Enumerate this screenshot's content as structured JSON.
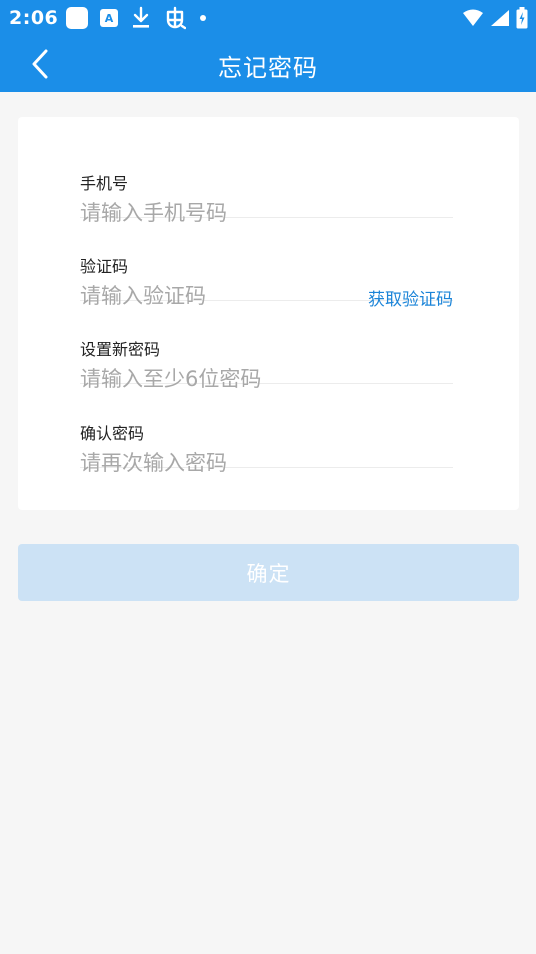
{
  "status_bar": {
    "time": "2:06",
    "notification_icons": [
      "square-icon",
      "a-badge-icon",
      "download-icon",
      "bug-icon",
      "dot-icon"
    ],
    "a_badge_text": "A",
    "system_icons": [
      "wifi-icon",
      "signal-icon",
      "battery-charging-icon"
    ]
  },
  "header": {
    "title": "忘记密码",
    "back_icon": "chevron-left-icon"
  },
  "form": {
    "fields": [
      {
        "label": "手机号",
        "placeholder": "请输入手机号码",
        "value": ""
      },
      {
        "label": "验证码",
        "placeholder": "请输入验证码",
        "value": "",
        "action": "获取验证码"
      },
      {
        "label": "设置新密码",
        "placeholder": "请输入至少6位密码",
        "value": ""
      },
      {
        "label": "确认密码",
        "placeholder": "请再次输入密码",
        "value": ""
      }
    ]
  },
  "submit": {
    "label": "确定"
  },
  "colors": {
    "primary": "#1b8ee8",
    "link": "#1b84d8",
    "button_disabled": "#cce2f5",
    "background": "#f6f6f6"
  }
}
